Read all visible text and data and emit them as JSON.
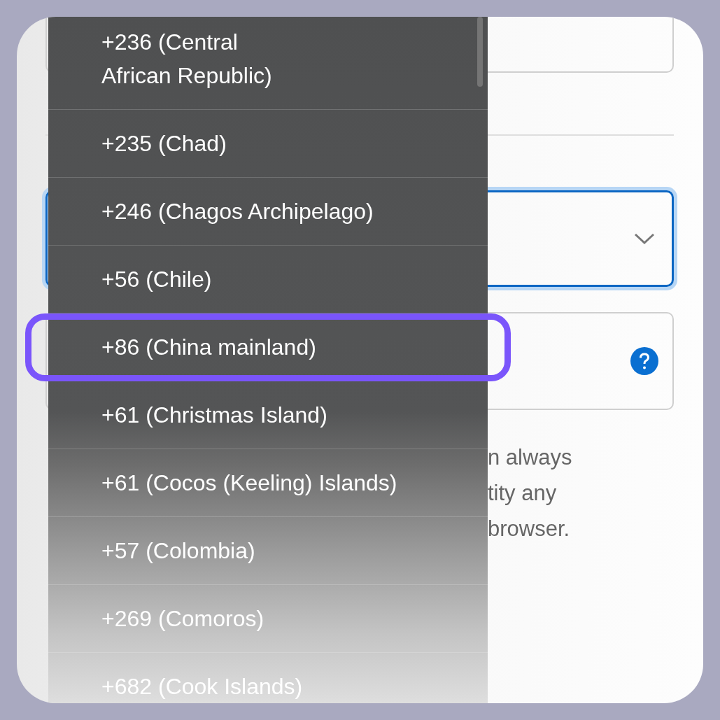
{
  "page": {
    "paragraph_lines": [
      "n always",
      "tity any",
      "browser."
    ]
  },
  "country_code_list": {
    "items": [
      {
        "label": "+236 (Central\nAfrican Republic)",
        "selected": false
      },
      {
        "label": "+235 (Chad)",
        "selected": false
      },
      {
        "label": "+246 (Chagos Archipelago)",
        "selected": false
      },
      {
        "label": "+56 (Chile)",
        "selected": false
      },
      {
        "label": "+86 (China mainland)",
        "selected": true
      },
      {
        "label": "+61 (Christmas Island)",
        "selected": false
      },
      {
        "label": "+61 (Cocos (Keeling) Islands)",
        "selected": false
      },
      {
        "label": "+57 (Colombia)",
        "selected": false
      },
      {
        "label": "+269 (Comoros)",
        "selected": false
      },
      {
        "label": "+682 (Cook Islands)",
        "selected": false
      }
    ]
  }
}
